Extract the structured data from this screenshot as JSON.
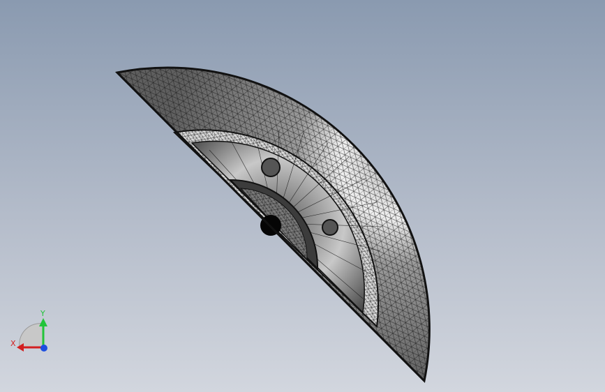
{
  "viewport": {
    "background_top": "#8a9ab0",
    "background_bottom": "#d2d6de"
  },
  "model": {
    "description_icon": "half-disc-mesh-section",
    "mesh_color": "#7d7d7d",
    "edge_color": "#111111"
  },
  "triad": {
    "x_label": "X",
    "y_label": "Y",
    "x_color": "#d31f1f",
    "y_color": "#22c43a",
    "z_color": "#1d4fe0"
  }
}
